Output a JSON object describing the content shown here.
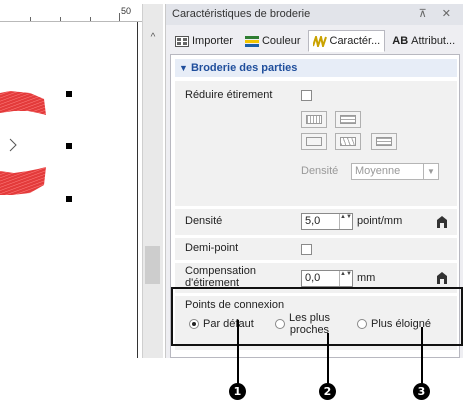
{
  "canvas": {
    "ruler_number": "50",
    "scroll_up_glyph": "^"
  },
  "panel": {
    "title": "Caractéristiques de broderie",
    "controls": "⊼ ✕",
    "tabs": [
      {
        "label": "Importer",
        "icon": "import-icon"
      },
      {
        "label": "Couleur",
        "icon": "color-icon"
      },
      {
        "label": "Caractér...",
        "icon": "character-icon",
        "active": true
      },
      {
        "label": "Attribut...",
        "icon": "attribute-icon"
      }
    ],
    "attr_prefix": "AB",
    "section": {
      "arrow": "▼",
      "title": "Broderie des parties"
    }
  },
  "rows": {
    "reduce_stretch": {
      "label": "Réduire étirement",
      "checked": false
    },
    "density_sub": {
      "label": "Densité",
      "value": "Moyenne",
      "dropdown_glyph": "▼"
    },
    "density": {
      "label": "Densité",
      "value": "5,0",
      "unit": "point/mm",
      "spin_glyph": "▲▼"
    },
    "half_stitch": {
      "label": "Demi-point",
      "checked": false
    },
    "compensation": {
      "label_line1": "Compensation",
      "label_line2": "d'étirement",
      "value": "0,0",
      "unit": "mm",
      "spin_glyph": "▲▼"
    }
  },
  "connection_points": {
    "label": "Points de connexion",
    "options": [
      {
        "label": "Par défaut",
        "selected": true
      },
      {
        "label_line1": "Les plus",
        "label_line2": "proches",
        "selected": false
      },
      {
        "label": "Plus éloigné",
        "selected": false
      }
    ]
  },
  "callouts": [
    "1",
    "2",
    "3"
  ],
  "colors": {
    "accent_blue": "#1f4e9c",
    "stitch_red": "#e33b3b",
    "callout": "#000000"
  }
}
